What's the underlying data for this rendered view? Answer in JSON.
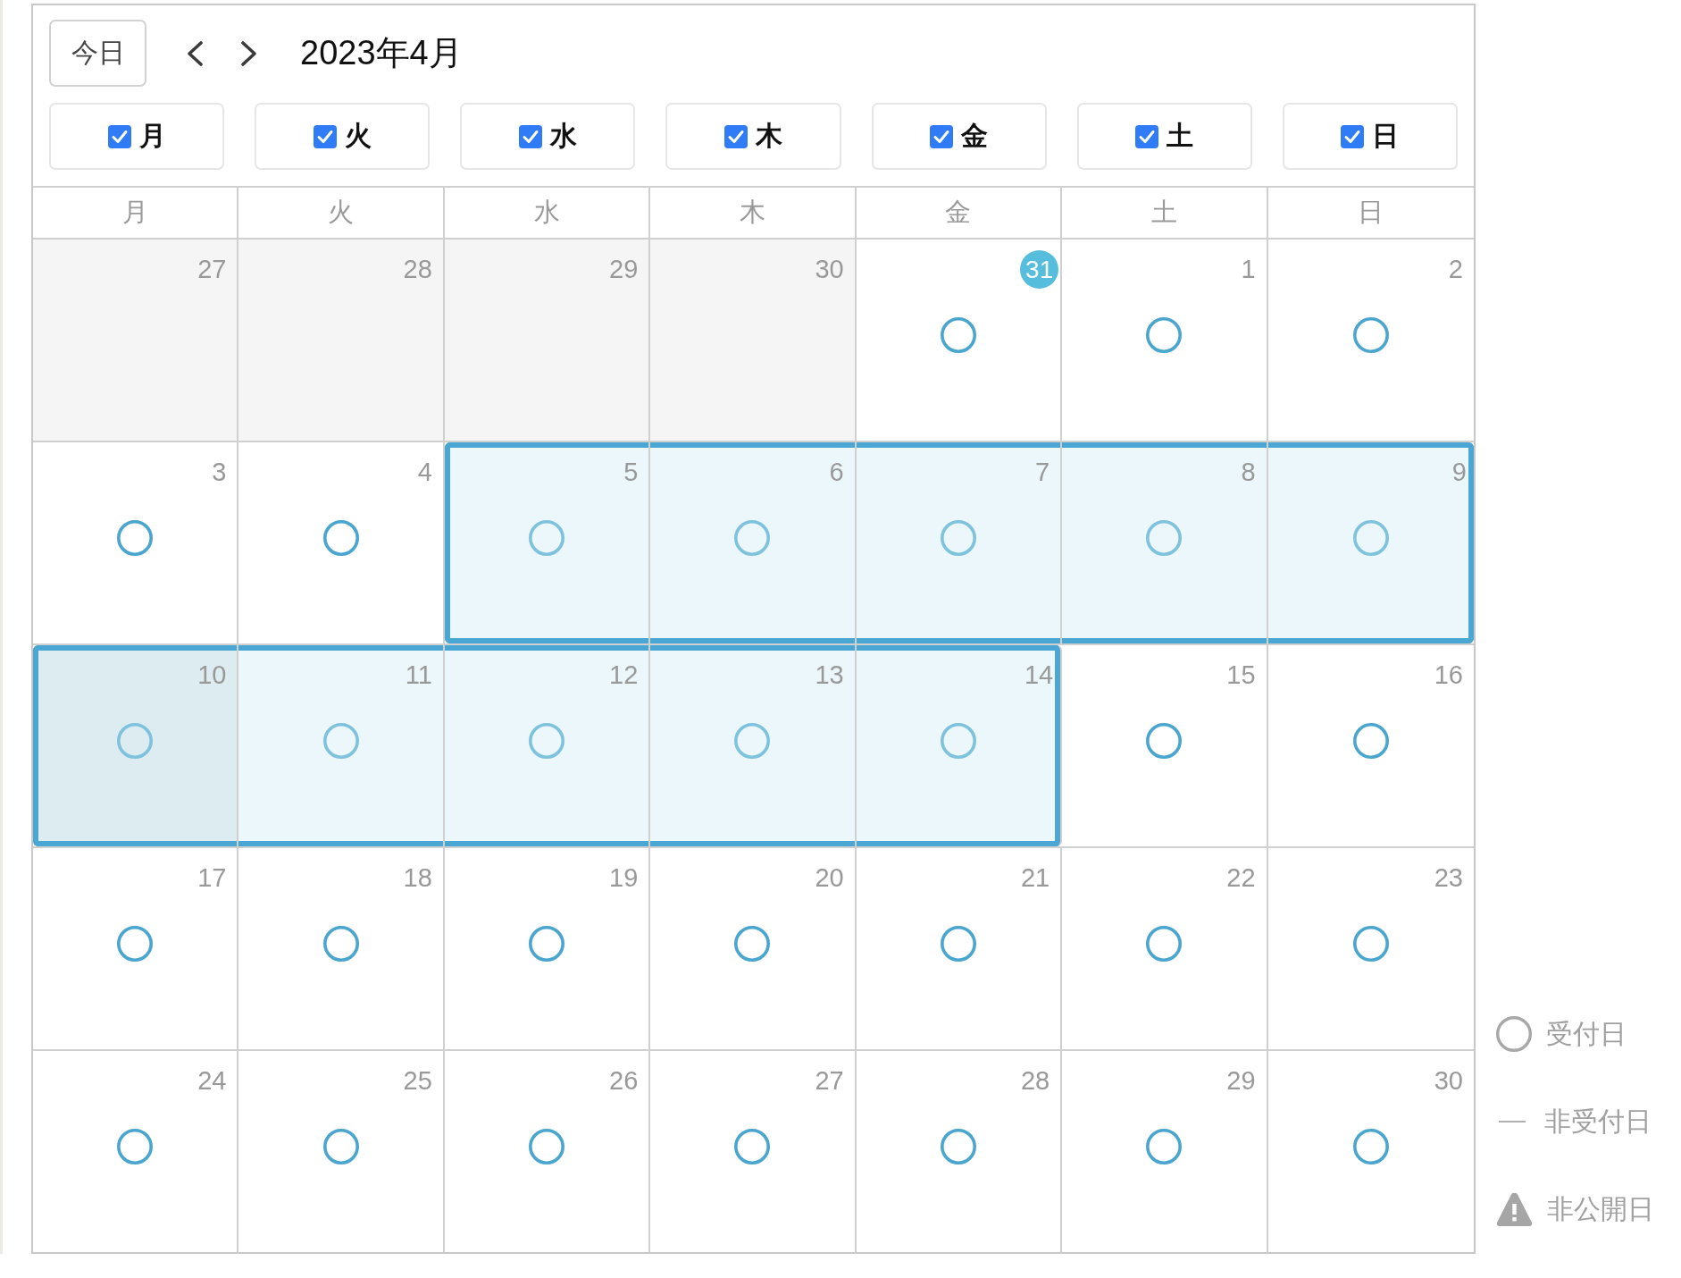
{
  "toolbar": {
    "today_button": "今日",
    "title": "2023年4月"
  },
  "weekday_filters": [
    {
      "label": "月",
      "checked": true
    },
    {
      "label": "火",
      "checked": true
    },
    {
      "label": "水",
      "checked": true
    },
    {
      "label": "木",
      "checked": true
    },
    {
      "label": "金",
      "checked": true
    },
    {
      "label": "土",
      "checked": true
    },
    {
      "label": "日",
      "checked": true
    }
  ],
  "calendar": {
    "weekdays": [
      "月",
      "火",
      "水",
      "木",
      "金",
      "土",
      "日"
    ],
    "weeks": [
      {
        "days": [
          {
            "day": "27",
            "kind": "past",
            "today": false,
            "selected": false,
            "hovered": false
          },
          {
            "day": "28",
            "kind": "past",
            "today": false,
            "selected": false,
            "hovered": false
          },
          {
            "day": "29",
            "kind": "past",
            "today": false,
            "selected": false,
            "hovered": false
          },
          {
            "day": "30",
            "kind": "past",
            "today": false,
            "selected": false,
            "hovered": false
          },
          {
            "day": "31",
            "kind": "open",
            "today": true,
            "selected": false,
            "hovered": false
          },
          {
            "day": "1",
            "kind": "open",
            "today": false,
            "selected": false,
            "hovered": false
          },
          {
            "day": "2",
            "kind": "open",
            "today": false,
            "selected": false,
            "hovered": false
          }
        ]
      },
      {
        "days": [
          {
            "day": "3",
            "kind": "open",
            "today": false,
            "selected": false,
            "hovered": false
          },
          {
            "day": "4",
            "kind": "open",
            "today": false,
            "selected": false,
            "hovered": false
          },
          {
            "day": "5",
            "kind": "open",
            "today": false,
            "selected": true,
            "hovered": false
          },
          {
            "day": "6",
            "kind": "open",
            "today": false,
            "selected": true,
            "hovered": false
          },
          {
            "day": "7",
            "kind": "open",
            "today": false,
            "selected": true,
            "hovered": false
          },
          {
            "day": "8",
            "kind": "open",
            "today": false,
            "selected": true,
            "hovered": false
          },
          {
            "day": "9",
            "kind": "open",
            "today": false,
            "selected": true,
            "hovered": false
          }
        ]
      },
      {
        "days": [
          {
            "day": "10",
            "kind": "open",
            "today": false,
            "selected": true,
            "hovered": true
          },
          {
            "day": "11",
            "kind": "open",
            "today": false,
            "selected": true,
            "hovered": false
          },
          {
            "day": "12",
            "kind": "open",
            "today": false,
            "selected": true,
            "hovered": false
          },
          {
            "day": "13",
            "kind": "open",
            "today": false,
            "selected": true,
            "hovered": false
          },
          {
            "day": "14",
            "kind": "open",
            "today": false,
            "selected": true,
            "hovered": false
          },
          {
            "day": "15",
            "kind": "open",
            "today": false,
            "selected": false,
            "hovered": false
          },
          {
            "day": "16",
            "kind": "open",
            "today": false,
            "selected": false,
            "hovered": false
          }
        ]
      },
      {
        "days": [
          {
            "day": "17",
            "kind": "open",
            "today": false,
            "selected": false,
            "hovered": false
          },
          {
            "day": "18",
            "kind": "open",
            "today": false,
            "selected": false,
            "hovered": false
          },
          {
            "day": "19",
            "kind": "open",
            "today": false,
            "selected": false,
            "hovered": false
          },
          {
            "day": "20",
            "kind": "open",
            "today": false,
            "selected": false,
            "hovered": false
          },
          {
            "day": "21",
            "kind": "open",
            "today": false,
            "selected": false,
            "hovered": false
          },
          {
            "day": "22",
            "kind": "open",
            "today": false,
            "selected": false,
            "hovered": false
          },
          {
            "day": "23",
            "kind": "open",
            "today": false,
            "selected": false,
            "hovered": false
          }
        ]
      },
      {
        "days": [
          {
            "day": "24",
            "kind": "open",
            "today": false,
            "selected": false,
            "hovered": false
          },
          {
            "day": "25",
            "kind": "open",
            "today": false,
            "selected": false,
            "hovered": false
          },
          {
            "day": "26",
            "kind": "open",
            "today": false,
            "selected": false,
            "hovered": false
          },
          {
            "day": "27",
            "kind": "open",
            "today": false,
            "selected": false,
            "hovered": false
          },
          {
            "day": "28",
            "kind": "open",
            "today": false,
            "selected": false,
            "hovered": false
          },
          {
            "day": "29",
            "kind": "open",
            "today": false,
            "selected": false,
            "hovered": false
          },
          {
            "day": "30",
            "kind": "open",
            "today": false,
            "selected": false,
            "hovered": false
          }
        ]
      }
    ]
  },
  "legend": [
    {
      "kind": "open",
      "label": "受付日"
    },
    {
      "kind": "closed",
      "label": "非受付日"
    },
    {
      "kind": "private",
      "label": "非公開日"
    }
  ]
}
